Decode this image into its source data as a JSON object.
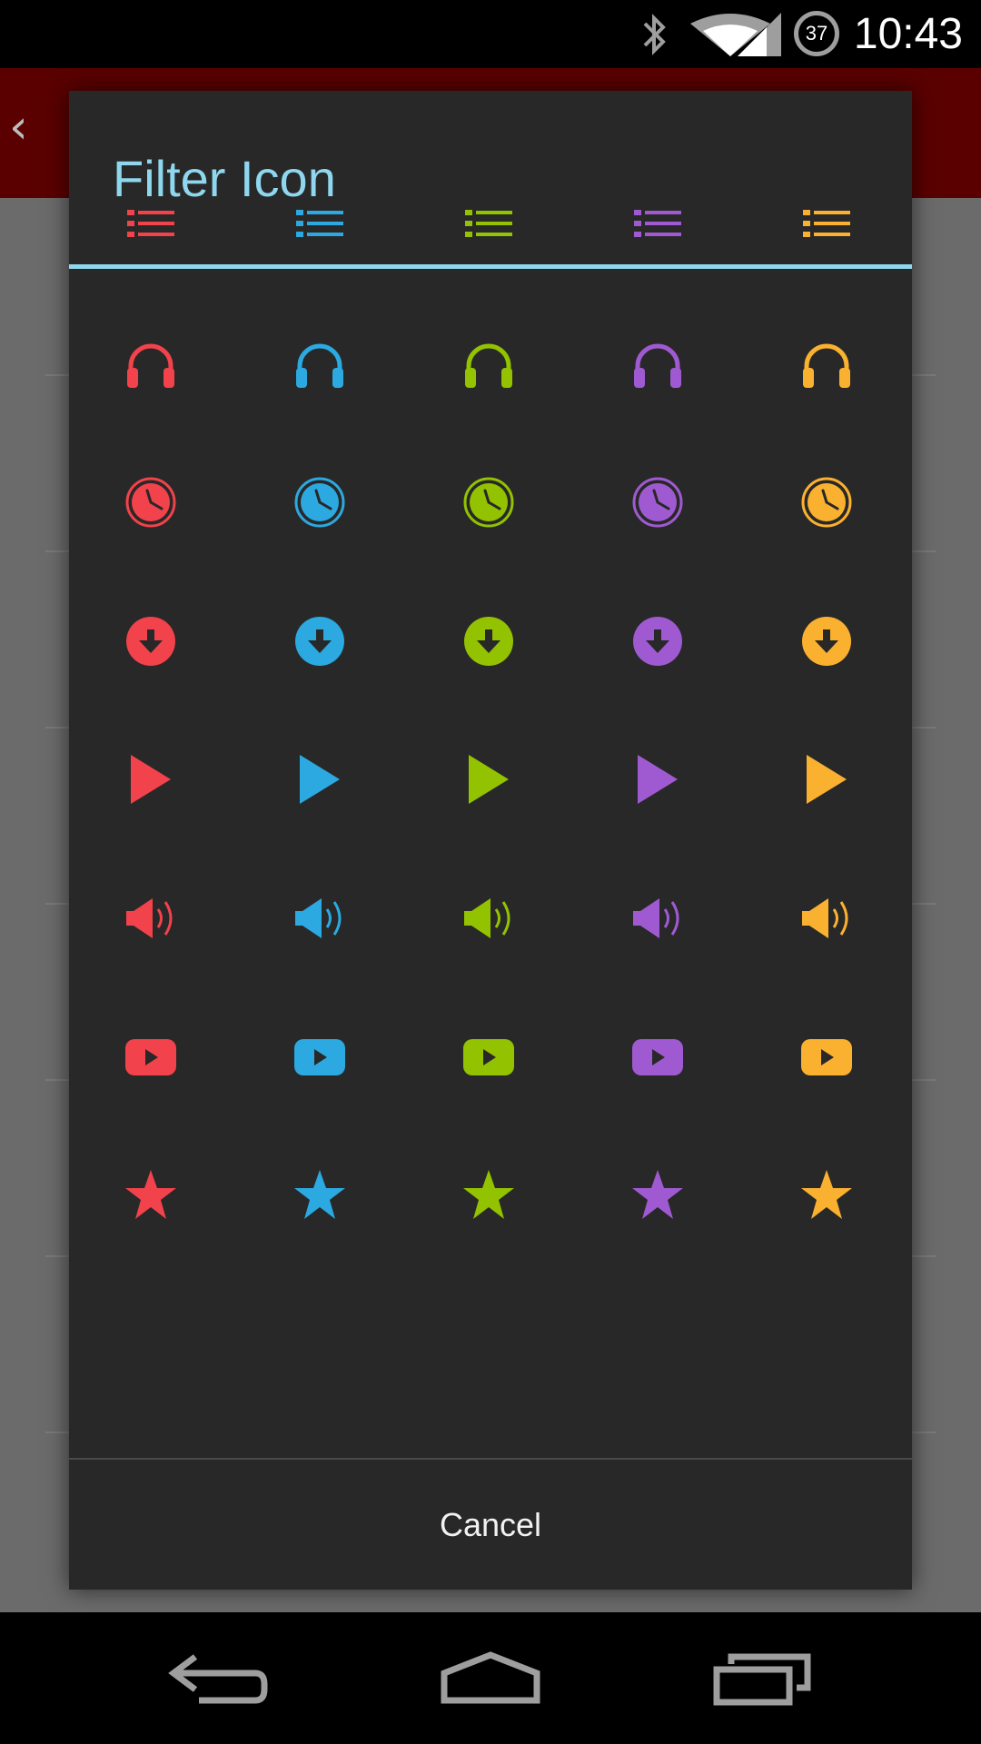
{
  "status_bar": {
    "time": "10:43",
    "battery_level": "37",
    "icons": [
      "bluetooth-icon",
      "wifi-icon",
      "cellular-signal-icon",
      "battery-icon"
    ]
  },
  "dialog": {
    "title": "Filter Icon",
    "cancel_label": "Cancel",
    "title_color": "#8ed7ee"
  },
  "icon_grid": {
    "colors": [
      "#f2424b",
      "#2ba9e0",
      "#92c200",
      "#a05ad1",
      "#fbb130"
    ],
    "rows": [
      "list-icon",
      "headphones-icon",
      "clock-icon",
      "download-icon",
      "play-icon",
      "volume-icon",
      "video-play-icon",
      "star-icon"
    ]
  },
  "nav_bar": {
    "buttons": [
      "back-icon",
      "home-icon",
      "recent-apps-icon"
    ]
  }
}
